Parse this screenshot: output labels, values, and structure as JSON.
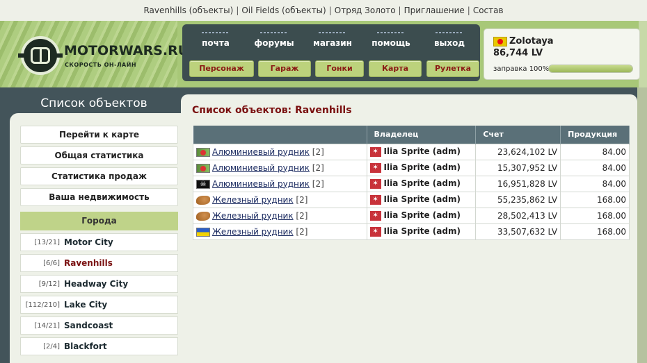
{
  "top_links": [
    "Ravenhills (объекты)",
    "Oil Fields (объекты)",
    "Отряд Золото",
    "Приглашение",
    "Состав"
  ],
  "logo": {
    "name": "MOTORWARS.RU",
    "tagline": "СКОРОСТЬ ОН-ЛАЙН"
  },
  "nav_top": [
    "почта",
    "форумы",
    "магазин",
    "помощь",
    "выход"
  ],
  "nav_buttons": [
    "Персонаж",
    "Гараж",
    "Гонки",
    "Карта",
    "Рулетка"
  ],
  "user": {
    "name": "Zolotaya",
    "money": "86,744 LV",
    "fuel_label": "заправка 100%",
    "fuel_percent": 100
  },
  "sidebar": {
    "title": "Список объектов",
    "menu": [
      "Перейти к карте",
      "Общая статистика",
      "Статистика продаж",
      "Ваша недвижимость"
    ],
    "section": "Города",
    "cities": [
      {
        "count": "[13/21]",
        "name": "Motor City",
        "active": false
      },
      {
        "count": "[6/6]",
        "name": "Ravenhills",
        "active": true
      },
      {
        "count": "[9/12]",
        "name": "Headway City",
        "active": false
      },
      {
        "count": "[112/210]",
        "name": "Lake City",
        "active": false
      },
      {
        "count": "[14/21]",
        "name": "Sandcoast",
        "active": false
      },
      {
        "count": "[2/4]",
        "name": "Blackfort",
        "active": false
      }
    ]
  },
  "main": {
    "heading": "Список объектов: Ravenhills",
    "columns": [
      "",
      "Владелец",
      "Счет",
      "Продукция"
    ],
    "rows": [
      {
        "icon": "aluminium-flag-icon",
        "name": "Алюминиевый рудник",
        "level": "[2]",
        "owner": "Ilia Sprite (adm)",
        "account": "23,624,102 LV",
        "production": "84.00"
      },
      {
        "icon": "aluminium-flag-icon",
        "name": "Алюминиевый рудник",
        "level": "[2]",
        "owner": "Ilia Sprite (adm)",
        "account": "15,307,952 LV",
        "production": "84.00"
      },
      {
        "icon": "pirate-flag-icon",
        "name": "Алюминиевый рудник",
        "level": "[2]",
        "owner": "Ilia Sprite (adm)",
        "account": "16,951,828 LV",
        "production": "84.00"
      },
      {
        "icon": "iron-ore-icon",
        "name": "Железный рудник",
        "level": "[2]",
        "owner": "Ilia Sprite (adm)",
        "account": "55,235,862 LV",
        "production": "168.00"
      },
      {
        "icon": "iron-ore-icon",
        "name": "Железный рудник",
        "level": "[2]",
        "owner": "Ilia Sprite (adm)",
        "account": "28,502,413 LV",
        "production": "168.00"
      },
      {
        "icon": "ukraine-flag-icon",
        "name": "Железный рудник",
        "level": "[2]",
        "owner": "Ilia Sprite (adm)",
        "account": "33,507,632 LV",
        "production": "168.00"
      }
    ]
  }
}
